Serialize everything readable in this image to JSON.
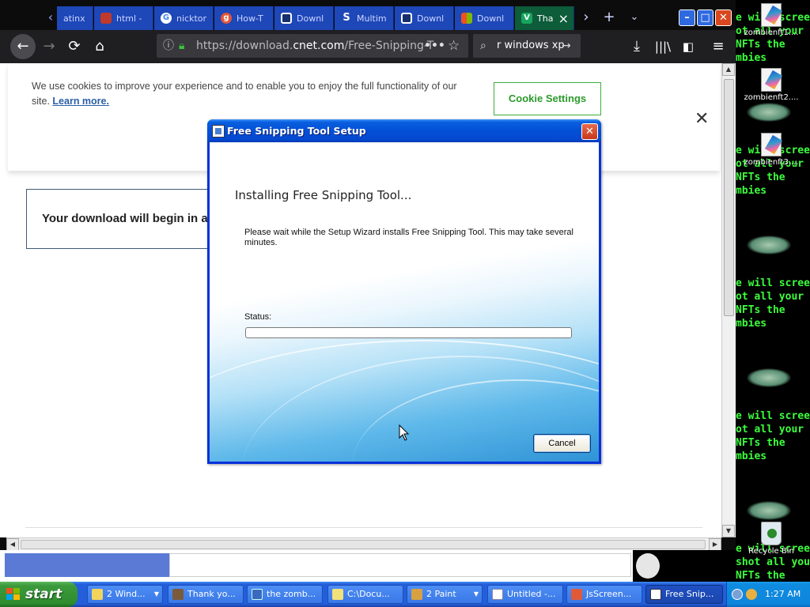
{
  "browser": {
    "tabs": [
      {
        "label": "atinx",
        "icon": "tab-favicon-icon"
      },
      {
        "label": "html -",
        "icon": "tab-favicon-icon"
      },
      {
        "label": "nicktor",
        "icon": "google-icon"
      },
      {
        "label": "How-T",
        "icon": "tab-favicon-icon"
      },
      {
        "label": "Downl",
        "icon": "tab-favicon-icon"
      },
      {
        "label": "Multim",
        "icon": "tab-favicon-icon"
      },
      {
        "label": "Downl",
        "icon": "tab-favicon-icon"
      },
      {
        "label": "Downl",
        "icon": "microsoft-icon"
      },
      {
        "label": "Tha",
        "icon": "tab-favicon-icon"
      }
    ],
    "url_prefix": "https://download.",
    "url_host": "cnet.com",
    "url_path": "/Free-Snipping-T",
    "search_value": "r windows xp",
    "accent_color": "#1e47b8"
  },
  "page": {
    "cookie_text": "We use cookies to improve your experience and to enable you to enjoy the full functionality of our site.",
    "cookie_link": "Learn more.",
    "cookie_settings_label": "Cookie Settings",
    "download_text": "Your download will begin in a"
  },
  "dialog": {
    "title": "Free Snipping Tool Setup",
    "heading": "Installing Free Snipping Tool...",
    "description": "Please wait while the Setup Wizard installs Free Snipping Tool.  This may take several minutes.",
    "status_label": "Status:",
    "progress": 0,
    "cancel_label": "Cancel"
  },
  "desktop": {
    "green_text": "e will screen\not all your\nNFTs the\nmbies",
    "green_text_bottom": "e will screen\nshot all your\nNFTs the",
    "icons": [
      {
        "label": "zombienft1...."
      },
      {
        "label": "zombienft2...."
      },
      {
        "label": "zombienft3...."
      },
      {
        "label": "Recycle Bin"
      }
    ]
  },
  "taskbar": {
    "start_label": "start",
    "tasks": [
      {
        "label": "2 Wind...",
        "has_caret": true
      },
      {
        "label": "Thank yo..."
      },
      {
        "label": "the zomb..."
      },
      {
        "label": "C:\\Docu..."
      },
      {
        "label": "2 Paint",
        "has_caret": true
      },
      {
        "label": "Untitled -..."
      },
      {
        "label": "JsScreen..."
      },
      {
        "label": "Free Snip..."
      }
    ],
    "clock": "1:27 AM"
  }
}
